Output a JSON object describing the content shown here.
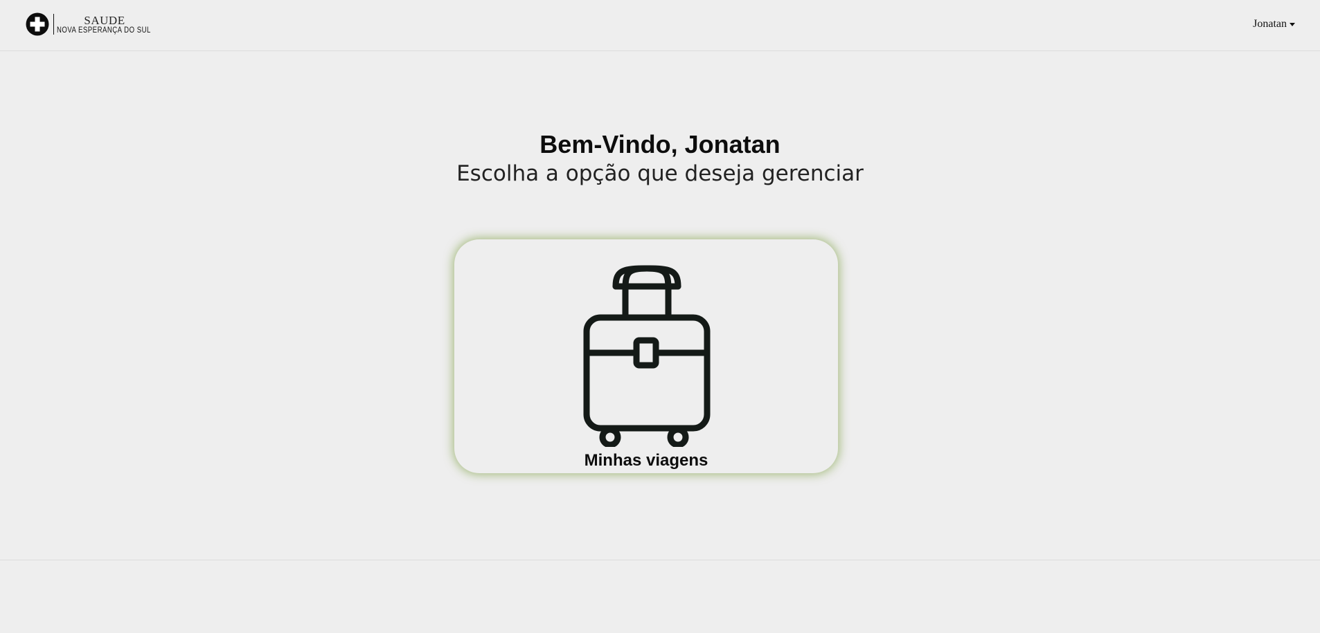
{
  "brand": {
    "top_text": "SAUDE",
    "bottom_text": "NOVA ESPERANÇA DO SUL",
    "mark_icon": "medical-cross-icon"
  },
  "user_menu": {
    "name": "Jonatan"
  },
  "main": {
    "welcome": "Bem-Vindo, Jonatan",
    "subtitle": "Escolha a opção que deseja gerenciar"
  },
  "cards": [
    {
      "label": "Minhas viagens",
      "icon": "suitcase-icon",
      "glow_color": "#8caa5a"
    }
  ]
}
